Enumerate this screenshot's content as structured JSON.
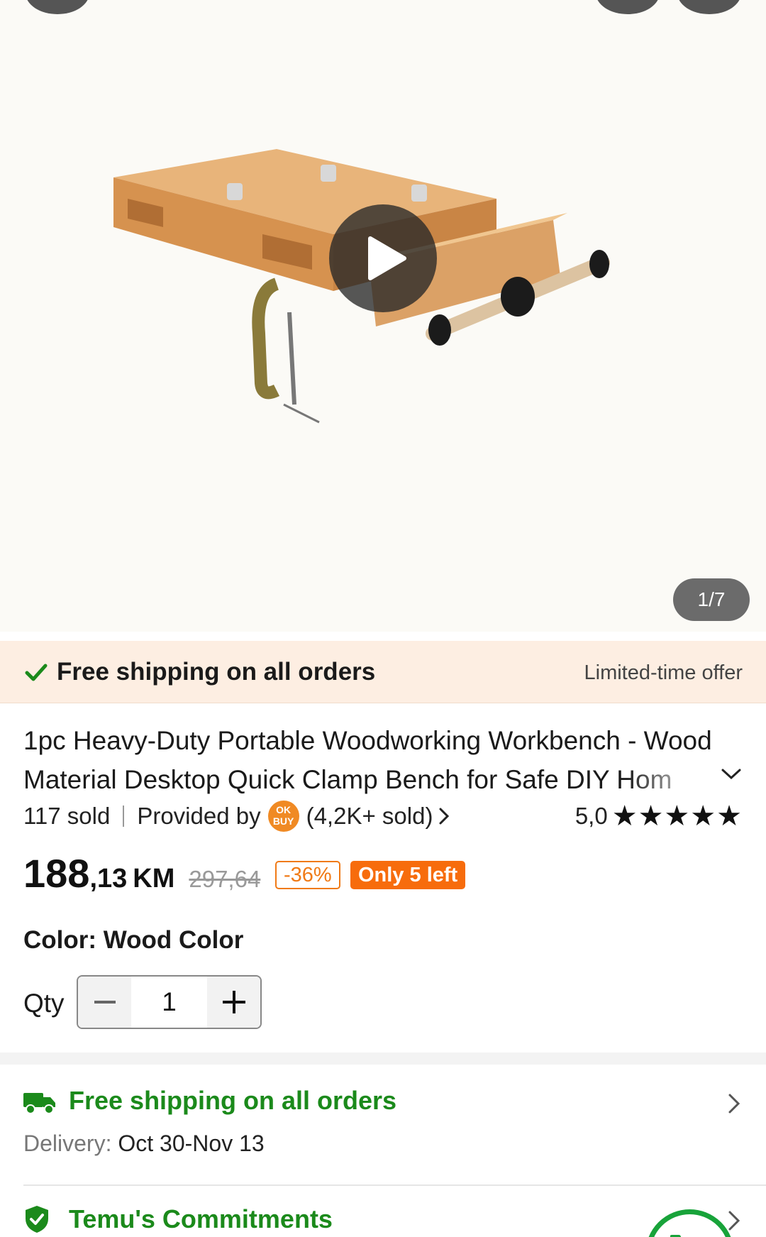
{
  "gallery": {
    "counter": "1/7"
  },
  "banner": {
    "title": "Free shipping on all orders",
    "offer": "Limited-time offer"
  },
  "product": {
    "title": "1pc Heavy-Duty Portable Woodworking Workbench - Wood Material Desktop Quick Clamp Bench for Safe DIY Hom",
    "sold": "117 sold",
    "provided_by": "Provided by",
    "seller_badge_top": "OK",
    "seller_badge_bottom": "BUY",
    "seller_sold": "(4,2K+ sold)",
    "rating": "5,0",
    "stars": "★★★★★"
  },
  "price": {
    "integer": "188",
    "decimal": ",13",
    "currency": "KM",
    "original": "297,64",
    "discount": "-36%",
    "stock": "Only 5 left"
  },
  "options": {
    "color_line": "Color: Wood Color",
    "qty_label": "Qty",
    "qty_value": "1"
  },
  "shipping": {
    "title": "Free shipping on all orders",
    "delivery_label": "Delivery:",
    "delivery_value": "Oct 30-Nov 13"
  },
  "commitments": {
    "title": "Temu's Commitments"
  },
  "colors": {
    "accent_orange": "#f76c0c",
    "green": "#1b8a1b",
    "banner_bg": "#fdeee2"
  }
}
